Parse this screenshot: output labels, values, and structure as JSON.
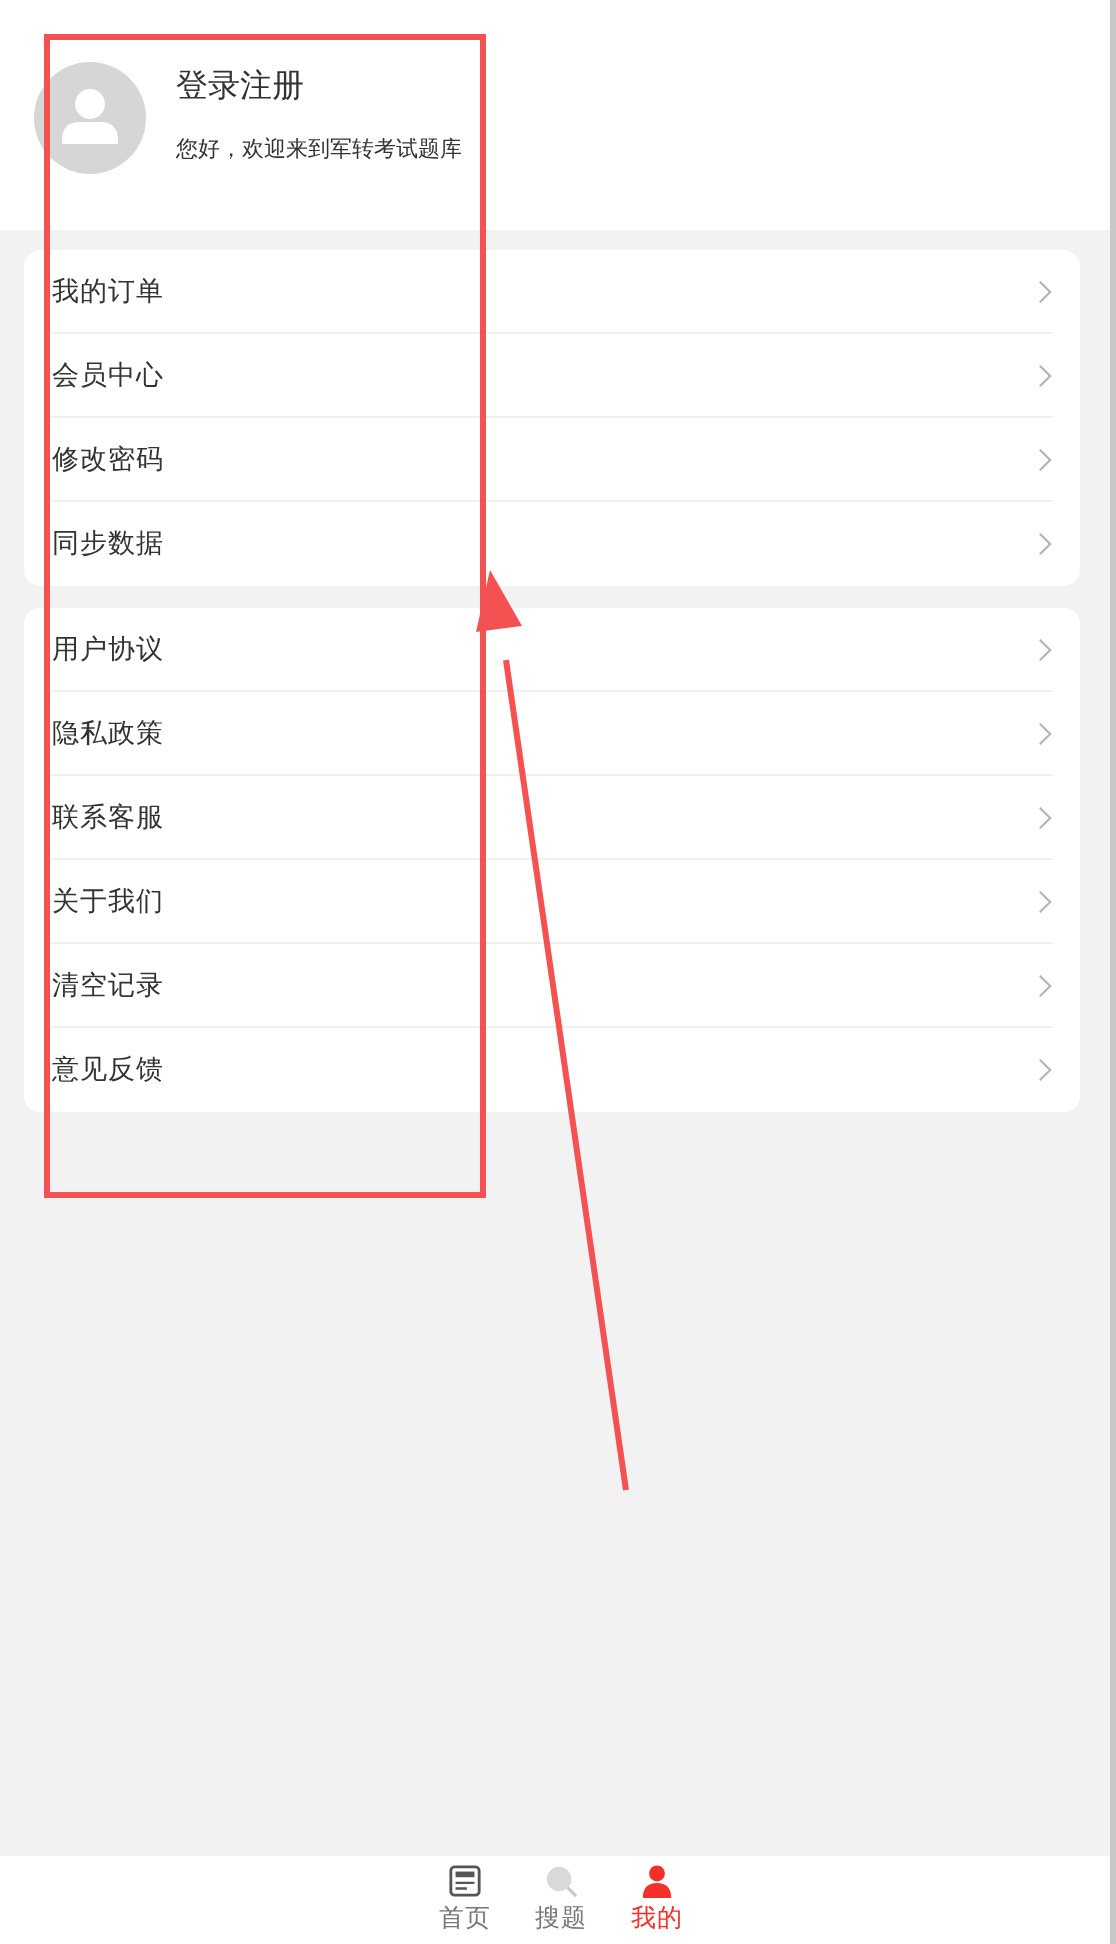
{
  "profile": {
    "title": "登录注册",
    "subtitle": "您好，欢迎来到军转考试题库"
  },
  "menu_groups": [
    {
      "items": [
        "我的订单",
        "会员中心",
        "修改密码",
        "同步数据"
      ]
    },
    {
      "items": [
        "用户协议",
        "隐私政策",
        "联系客服",
        "关于我们",
        "清空记录",
        "意见反馈"
      ]
    }
  ],
  "tab_bar": [
    {
      "label": "首页",
      "kind": "home",
      "selected": false
    },
    {
      "label": "搜题",
      "kind": "search",
      "selected": false
    },
    {
      "label": "我的",
      "kind": "profile",
      "selected": true
    }
  ]
}
